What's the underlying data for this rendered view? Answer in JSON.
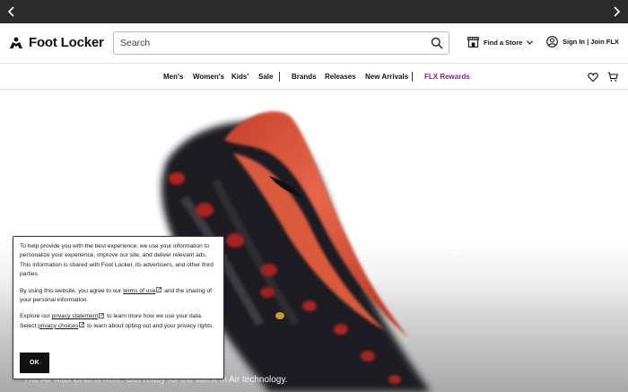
{
  "promo_bar": {
    "prev_label": "‹",
    "next_label": "›"
  },
  "header": {
    "logo_text": "Foot Locker",
    "search": {
      "placeholder": "Search",
      "value": ""
    },
    "find_store_label": "Find a Store",
    "sign_in_label": "Sign In | Join FLX"
  },
  "nav": {
    "items": [
      "Men's",
      "Women's",
      "Kids'",
      "Sale",
      "Brands",
      "Releases",
      "New Arrivals",
      "FLX Rewards"
    ],
    "rewards_color": "#a8117f"
  },
  "hero": {
    "caption": "The Air Max DN8 is here. Get ready for the latest in Air technology."
  },
  "cookie": {
    "para1": "To help provide you with the best experience, we use your information to personalize your experience, improve our site, and deliver relevant ads. This information is shared with Foot Locker, its advertisers, and other third parties.",
    "para2_before": "By using this website, you agree to our ",
    "para2_link": "terms of use",
    "para2_after": " and the sharing of your personal information.",
    "para3_before": "Explore our ",
    "para3_link1": "privacy statement",
    "para3_mid": " to learn more how we use your data. Select ",
    "para3_link2": "privacy choices",
    "para3_after": " to learn about opting out and your privacy rights.",
    "ok_label": "OK"
  },
  "icons": {
    "logo": "referee-logo-icon",
    "search": "search-icon",
    "store": "store-icon",
    "chevron": "chevron-down-icon",
    "account": "account-icon",
    "wishlist": "heart-icon",
    "cart": "cart-icon",
    "external": "external-link-icon"
  }
}
